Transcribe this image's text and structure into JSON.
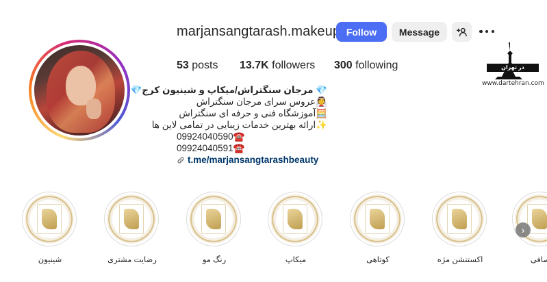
{
  "profile": {
    "username": "marjansangtarash.makeup",
    "follow_label": "Follow",
    "message_label": "Message",
    "add_user_icon": "add-user-icon",
    "more_icon": "more-options-icon",
    "stats": {
      "posts_count": "53",
      "posts_label": " posts",
      "followers_count": "13.7K",
      "followers_label": " followers",
      "following_count": "300",
      "following_label": " following"
    },
    "bio": {
      "name": "💎 مرجان سنگتراش/میکاپ و شینیون کرج💎",
      "line1": "👰عروس سرای مرجان سنگتراش",
      "line2": "🧮آموزشگاه فنی و حرفه ای سنگتراش",
      "line3": "✨ارائه بهترین خدمات زیبایی در تمامی لاین ها",
      "phone1": "09924040590☎️",
      "phone2": "09924040591☎️",
      "link": "t.me/marjansangtarashbeauty"
    }
  },
  "watermark": {
    "banner": "در تهران",
    "site": "www.dartehran.com"
  },
  "highlights": [
    {
      "label": "شینیون"
    },
    {
      "label": "رضایت مشتری"
    },
    {
      "label": "رنگ مو"
    },
    {
      "label": "میکاپ"
    },
    {
      "label": "کوتاهی"
    },
    {
      "label": "اکستنشن مژه"
    },
    {
      "label": "صافی"
    }
  ],
  "colors": {
    "accent": "#4c6ef5",
    "link": "#00376b",
    "text": "#262626"
  }
}
